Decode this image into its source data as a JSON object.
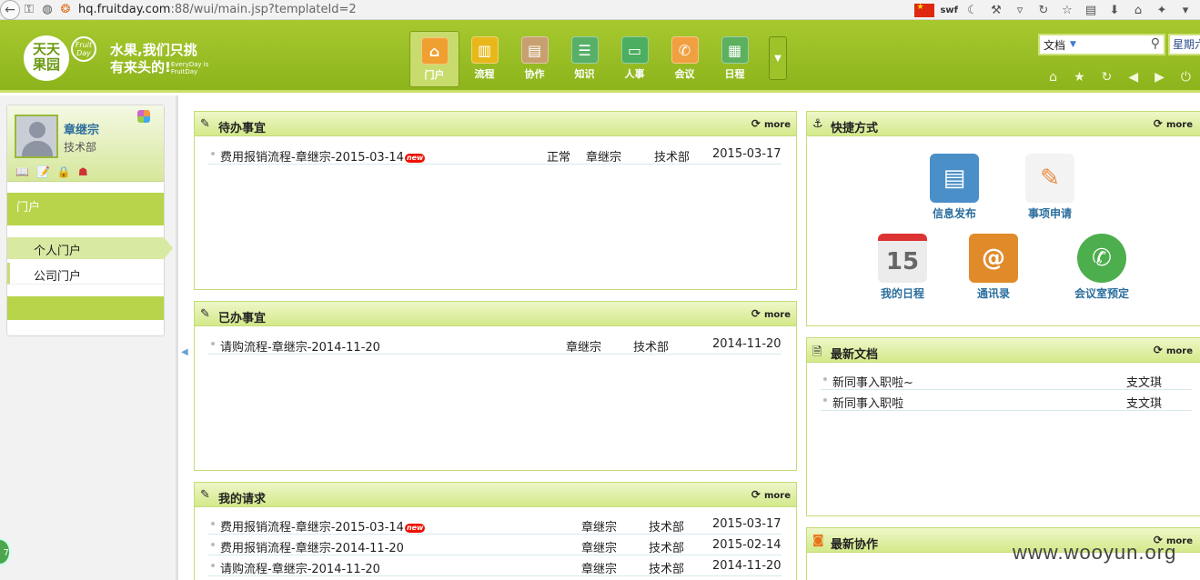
{
  "browser": {
    "url_host": "hq.fruitday.com",
    "url_rest": ":88/wui/main.jsp?templateId=2",
    "plugin_label": "swf"
  },
  "header": {
    "logo_line1": "天天",
    "logo_line2": "果园",
    "logo_fruit_line1": "Fruit",
    "logo_fruit_line2": "Day",
    "slogan_line1": "水果,我们只挑",
    "slogan_line2": "有来头的!",
    "slogan_small_line1": "EveryDay is",
    "slogan_small_line2": "FruitDay",
    "nav": [
      {
        "label": "门户",
        "icon": "home-icon",
        "color": "#f0a030"
      },
      {
        "label": "流程",
        "icon": "bar-chart-icon",
        "color": "#e8b81a"
      },
      {
        "label": "协作",
        "icon": "clipboard-icon",
        "color": "#c8a070"
      },
      {
        "label": "知识",
        "icon": "database-icon",
        "color": "#58b068"
      },
      {
        "label": "人事",
        "icon": "printer-icon",
        "color": "#4cae60"
      },
      {
        "label": "会议",
        "icon": "phone-icon",
        "color": "#f0a040"
      },
      {
        "label": "日程",
        "icon": "calendar-icon",
        "color": "#5cb060"
      }
    ],
    "search_scope": "文档",
    "weekday": "星期六"
  },
  "sidebar": {
    "user_name": "章继宗",
    "user_dept": "技术部",
    "section_title": "门户",
    "items": [
      {
        "label": "个人门户"
      },
      {
        "label": "公司门户"
      }
    ]
  },
  "panels": {
    "more_label": "more",
    "todo": {
      "title": "待办事宜",
      "rows": [
        {
          "title": "费用报销流程-章继宗-2015-03-14",
          "is_new": true,
          "status": "正常",
          "creator": "章继宗",
          "dept": "技术部",
          "date": "2015-03-17"
        }
      ]
    },
    "done": {
      "title": "已办事宜",
      "rows": [
        {
          "title": "请购流程-章继宗-2014-11-20",
          "creator": "章继宗",
          "dept": "技术部",
          "date": "2014-11-20"
        }
      ]
    },
    "requests": {
      "title": "我的请求",
      "rows": [
        {
          "title": "费用报销流程-章继宗-2015-03-14",
          "is_new": true,
          "creator": "章继宗",
          "dept": "技术部",
          "date": "2015-03-17"
        },
        {
          "title": "费用报销流程-章继宗-2014-11-20",
          "creator": "章继宗",
          "dept": "技术部",
          "date": "2015-02-14"
        },
        {
          "title": "请购流程-章继宗-2014-11-20",
          "creator": "章继宗",
          "dept": "技术部",
          "date": "2014-11-20"
        }
      ]
    },
    "shortcuts": {
      "title": "快捷方式",
      "items": [
        {
          "label": "信息发布",
          "icon": "cabinet-icon",
          "color": "#4a8fc8"
        },
        {
          "label": "事项申请",
          "icon": "pencil-icon",
          "color": "#e88a3a"
        },
        {
          "label": "我的日程",
          "icon": "calendar-page-icon",
          "color": "#d9d9d9"
        },
        {
          "label": "通讯录",
          "icon": "address-book-icon",
          "color": "#e08a2a"
        },
        {
          "label": "会议室预定",
          "icon": "phone-icon",
          "color": "#4cae4c"
        }
      ]
    },
    "docs": {
      "title": "最新文档",
      "rows": [
        {
          "title": "新同事入职啦~",
          "author": "支文琪"
        },
        {
          "title": "新同事入职啦",
          "author": "支文琪"
        }
      ]
    },
    "collab": {
      "title": "最新协作"
    }
  },
  "new_badge": "new",
  "watermark": "www.wooyun.org",
  "calendar_day": "15"
}
